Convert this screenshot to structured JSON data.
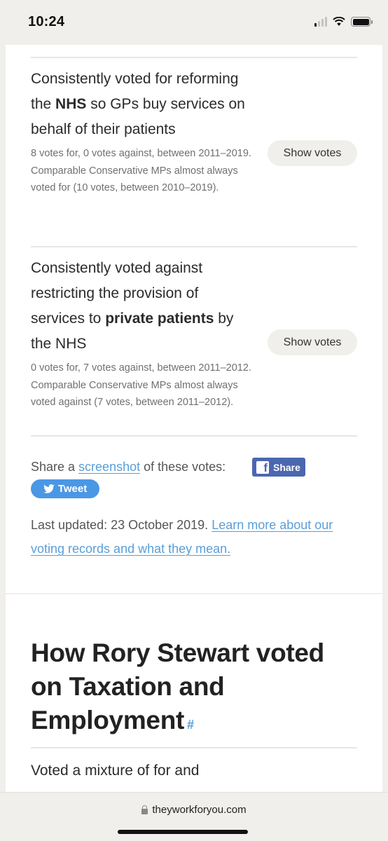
{
  "status_bar": {
    "time": "10:24",
    "icons": [
      "cellular-signal-icon",
      "wifi-icon",
      "battery-icon"
    ]
  },
  "votes_section": {
    "policies": [
      {
        "text_before": "Consistently voted for reforming the ",
        "text_bold": "NHS",
        "text_after": " so GPs buy services on behalf of their patients",
        "detail": "8 votes for, 0 votes against, between 2011–2019. Comparable Conservative MPs al­most always voted for (10 votes, between 2010–2019).",
        "button_label": "Show votes"
      },
      {
        "text_before": "Consistently voted against restricting the provision of services to ",
        "text_bold": "private patients",
        "text_after": " by the NHS",
        "detail": "0 votes for, 7 votes against, between 2011–2012. Comparable Conservative MPs al­most always voted against (7 votes, be­tween 2011–2012).",
        "button_label": "Show votes"
      }
    ],
    "share": {
      "prefix": "Share a ",
      "link_text": "screenshot",
      "suffix": " of these votes:",
      "facebook_label": "Share",
      "twitter_label": "Tweet"
    },
    "last_updated": {
      "text": "Last updated: 23 October 2019. ",
      "link_text": "Learn more about our voting records and what they mean."
    }
  },
  "next_section": {
    "heading": "How Rory Stewart voted on Taxation and Employment",
    "anchor": "#",
    "first_policy_partial": "Voted a mixture of for and"
  },
  "browser": {
    "url": "theyworkforyou.com"
  },
  "colors": {
    "page_bg": "#f0efeb",
    "link": "#5a9ed8",
    "facebook": "#4b67b0",
    "twitter": "#4a97e6"
  }
}
